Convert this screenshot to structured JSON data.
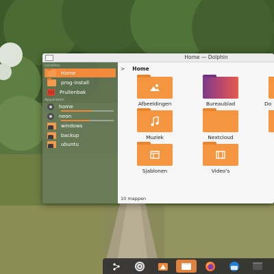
{
  "window": {
    "title": "Home — Dolphin"
  },
  "sidebar": {
    "places_header": "Locaties",
    "devices_header": "Apparaten",
    "places": [
      {
        "label": "Home",
        "icon": "home-folder-icon",
        "active": true
      },
      {
        "label": "prog-install",
        "icon": "folder-icon",
        "active": false
      },
      {
        "label": "Prullenbak",
        "icon": "trash-icon",
        "active": false
      }
    ],
    "devices": [
      {
        "label": "home",
        "icon": "disk-icon",
        "usage": 0.6
      },
      {
        "label": "neon",
        "icon": "disk-icon",
        "usage": 0.55
      },
      {
        "label": "windows",
        "icon": "drive-folder-icon"
      },
      {
        "label": "backup",
        "icon": "drive-folder-icon"
      },
      {
        "label": "ubuntu",
        "icon": "drive-folder-icon"
      }
    ]
  },
  "breadcrumb": {
    "separator": ">",
    "current": "Home"
  },
  "files": [
    {
      "label": "Afbeeldingen",
      "emblem": "picture-icon"
    },
    {
      "label": "Bureaublad",
      "emblem": "desktop-icon"
    },
    {
      "label": "Do",
      "emblem": "document-icon"
    },
    {
      "label": "Muziek",
      "emblem": "music-note-icon"
    },
    {
      "label": "Nextcloud",
      "emblem": "folder-icon"
    },
    {
      "label": "Sjablonen",
      "emblem": "template-icon"
    },
    {
      "label": "Video's",
      "emblem": "film-icon"
    }
  ],
  "status": {
    "text": "10 mappen"
  },
  "dock": {
    "items": [
      {
        "name": "launcher-icon"
      },
      {
        "name": "kde-connect-icon"
      },
      {
        "name": "software-store-icon"
      },
      {
        "name": "dolphin-icon",
        "active": true
      },
      {
        "name": "firefox-icon"
      },
      {
        "name": "thunderbird-icon"
      },
      {
        "name": "terminal-icon"
      }
    ]
  },
  "colors": {
    "accent": "#f0893a",
    "folder": "#f4963f"
  }
}
